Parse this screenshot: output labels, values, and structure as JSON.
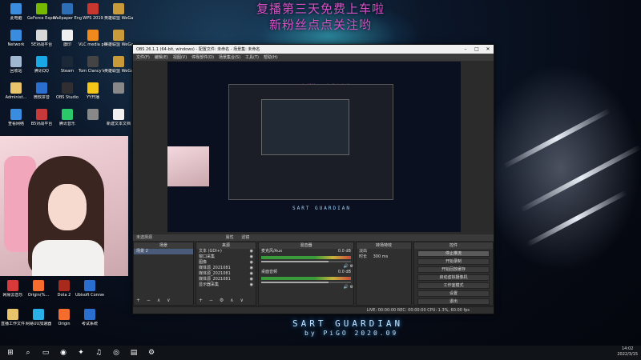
{
  "overlay": {
    "line1": "复播第三天免费上车啦",
    "line2": "新粉丝点点关注哟"
  },
  "desktop_icons": [
    {
      "label": "此电脑",
      "icon": "computer-icon",
      "color": "#3a8dde"
    },
    {
      "label": "GeForce Experience",
      "icon": "geforce-icon",
      "color": "#76b900"
    },
    {
      "label": "Wallpaper Engine: ...",
      "icon": "wallpaper-engine-icon",
      "color": "#2c6fb7"
    },
    {
      "label": "WPS 2019",
      "icon": "wps-icon",
      "color": "#c8372d"
    },
    {
      "label": "英雄联盟 WeGame版",
      "icon": "lol-wegame-icon",
      "color": "#c89a3a"
    },
    {
      "label": "Network",
      "icon": "network-icon",
      "color": "#3a8dde"
    },
    {
      "label": "5E对战平台",
      "icon": "5e-icon",
      "color": "#d8d8d8"
    },
    {
      "label": "旗印",
      "icon": "app-icon",
      "color": "#f0f0f0"
    },
    {
      "label": "VLC media player",
      "icon": "vlc-icon",
      "color": "#f08a1c"
    },
    {
      "label": "英雄联盟 WeGame版",
      "icon": "lol-wegame-icon",
      "color": "#c89a3a"
    },
    {
      "label": "回收站",
      "icon": "recycle-bin-icon",
      "color": "#a0b8d0"
    },
    {
      "label": "腾讯QQ",
      "icon": "qq-icon",
      "color": "#1aa7e6"
    },
    {
      "label": "Steam",
      "icon": "steam-icon",
      "color": "#1b2838"
    },
    {
      "label": "Tom Clancy's ...",
      "icon": "ubisoft-game-icon",
      "color": "#444"
    },
    {
      "label": "英雄联盟 WeGame",
      "icon": "lol-wegame-icon",
      "color": "#c89a3a"
    },
    {
      "label": "Administ...",
      "icon": "user-folder-icon",
      "color": "#e8c46a"
    },
    {
      "label": "微软拼音",
      "icon": "ime-icon",
      "color": "#2a6fd0"
    },
    {
      "label": "OBS Studio",
      "icon": "obs-icon",
      "color": "#302e31"
    },
    {
      "label": "YY开播",
      "icon": "yy-icon",
      "color": "#f5c518"
    },
    {
      "label": "",
      "icon": "shortcut-icon",
      "color": "#888"
    },
    {
      "label": "查看网络",
      "icon": "network-view-icon",
      "color": "#3a8dde"
    },
    {
      "label": "B5对战平台",
      "icon": "b5-icon",
      "color": "#c83a3a"
    },
    {
      "label": "腾讯音乐",
      "icon": "music-icon",
      "color": "#2ac86a"
    },
    {
      "label": "",
      "icon": "app-icon",
      "color": "#888"
    },
    {
      "label": "新建文本文档",
      "icon": "text-file-icon",
      "color": "#f0f0f0"
    }
  ],
  "desktop_icons_lower": [
    {
      "label": "网易云音乐",
      "icon": "netease-music-icon",
      "color": "#d83a3a"
    },
    {
      "label": "Origin(%...",
      "icon": "origin-icon",
      "color": "#f56c2d"
    },
    {
      "label": "Dota 2",
      "icon": "dota2-icon",
      "color": "#a82a1c"
    },
    {
      "label": "Ubisoft Connect",
      "icon": "ubisoft-icon",
      "color": "#2a6fd0"
    },
    {
      "label": "直播工作文件",
      "icon": "folder-icon",
      "color": "#e8c46a"
    },
    {
      "label": "网易UU加速器",
      "icon": "uu-icon",
      "color": "#2ab0e8"
    },
    {
      "label": "Origin",
      "icon": "origin-icon",
      "color": "#f56c2d"
    },
    {
      "label": "考试系统",
      "icon": "exam-icon",
      "color": "#2a6fd0"
    }
  ],
  "obs": {
    "title": "OBS 26.1.1 (64-bit, windows) - 配置文件: 未命名 - 场景集: 未命名",
    "menu": [
      "文件(F)",
      "编辑(E)",
      "视图(V)",
      "停靠部件(D)",
      "场景集合(S)",
      "工具(T)",
      "帮助(H)"
    ],
    "preview_hud": "SART  GUARDIAN",
    "scene_bar_label": "未选择源",
    "properties_label": "属性",
    "filters_label": "滤镜",
    "docks": {
      "scenes": {
        "header": "场景",
        "items": [
          "场景 2"
        ]
      },
      "sources": {
        "header": "来源",
        "items": [
          "文本 (GDI+)",
          "窗口采集",
          "图像",
          "媒体源_2021081",
          "媒体源_2021081",
          "媒体源_2021081",
          "显示器采集"
        ]
      },
      "mixer": {
        "header": "混音器",
        "channels": [
          {
            "name": "麦克风/Aux",
            "db": "0.0 dB",
            "level": 0.75
          },
          {
            "name": "桌面音频",
            "db": "0.0 dB",
            "level": 0.75
          }
        ]
      },
      "transitions": {
        "header": "转场特效",
        "type": "淡出",
        "duration_label": "时长",
        "duration": "300 ms"
      },
      "controls": {
        "header": "控件",
        "buttons": [
          "停止推流",
          "开始录制",
          "开始回放缓存",
          "启动虚拟摄像机",
          "工作室模式",
          "设置",
          "退出"
        ]
      }
    },
    "status": "LIVE: 00:00:00   REC: 00:00:00   CPU: 1.3%, 60.00 fps"
  },
  "brand": {
    "main": "SART  GUARDIAN",
    "sub": "by PiGO  2020.09"
  },
  "taskbar": {
    "items": [
      "start-icon",
      "search-icon",
      "task-view-icon",
      "obs-icon",
      "game-icon",
      "music-icon",
      "chrome-icon",
      "folder-icon",
      "settings-icon"
    ],
    "time": "14:02",
    "date": "2022/3/15"
  }
}
